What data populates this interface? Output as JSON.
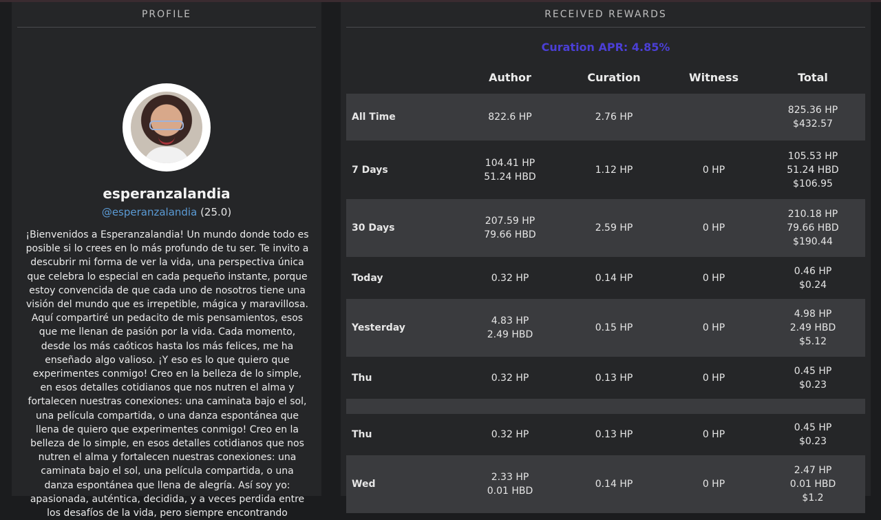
{
  "profile": {
    "header": "PROFILE",
    "display_name": "esperanzalandia",
    "handle": "@esperanzalandia",
    "reputation": "(25.0)",
    "bio": "¡Bienvenidos a Esperanzalandia! Un mundo donde todo es posible si lo crees en lo más profundo de tu ser. Te invito a descubrir mi forma de ver la vida, una perspectiva única que celebra lo especial en cada pequeño instante, porque estoy convencida de que cada uno de nosotros tiene una visión del mundo que es irrepetible, mágica y maravillosa. Aquí compartiré un pedacito de mis pensamientos, esos que me llenan de pasión por la vida. Cada momento, desde los más caóticos hasta los más felices, me ha enseñado algo valioso. ¡Y eso es lo que quiero que experimentes conmigo! Creo en la belleza de lo simple, en esos detalles cotidianos que nos nutren el alma y fortalecen nuestras conexiones: una caminata bajo el sol, una película compartida, o una danza espontánea que llena de quiero que experimentes conmigo! Creo en la belleza de lo simple, en esos detalles cotidianos que nos nutren el alma y fortalecen nuestras conexiones: una caminata bajo el sol, una película compartida, o una danza espontánea que llena de alegría. Así soy yo: apasionada, auténtica, decidida, y a veces perdida entre los desafíos de la vida, pero siempre encontrando"
  },
  "rewards": {
    "header": "RECEIVED REWARDS",
    "apr": "Curation APR: 4.85%",
    "columns": {
      "author": "Author",
      "curation": "Curation",
      "witness": "Witness",
      "total": "Total"
    },
    "rows": [
      {
        "label": "All Time",
        "author": [
          "822.6 HP"
        ],
        "curation": "2.76 HP",
        "witness": "",
        "total": [
          "825.36 HP",
          "$432.57"
        ]
      },
      {
        "label": "7 Days",
        "author": [
          "104.41 HP",
          "51.24 HBD"
        ],
        "curation": "1.12 HP",
        "witness": "0 HP",
        "total": [
          "105.53 HP",
          "51.24 HBD",
          "$106.95"
        ]
      },
      {
        "label": "30 Days",
        "author": [
          "207.59 HP",
          "79.66 HBD"
        ],
        "curation": "2.59 HP",
        "witness": "0 HP",
        "total": [
          "210.18 HP",
          "79.66 HBD",
          "$190.44"
        ]
      },
      {
        "label": "Today",
        "author": [
          "0.32 HP"
        ],
        "curation": "0.14 HP",
        "witness": "0 HP",
        "total": [
          "0.46 HP",
          "$0.24"
        ]
      },
      {
        "label": "Yesterday",
        "author": [
          "4.83 HP",
          "2.49 HBD"
        ],
        "curation": "0.15 HP",
        "witness": "0 HP",
        "total": [
          "4.98 HP",
          "2.49 HBD",
          "$5.12"
        ]
      },
      {
        "label": "Thu",
        "author": [
          "0.32 HP"
        ],
        "curation": "0.13 HP",
        "witness": "0 HP",
        "total": [
          "0.45 HP",
          "$0.23"
        ]
      },
      {
        "label": "Thu",
        "author": [
          "0.32 HP"
        ],
        "curation": "0.13 HP",
        "witness": "0 HP",
        "total": [
          "0.45 HP",
          "$0.23"
        ]
      },
      {
        "label": "Wed",
        "author": [
          "2.33 HP",
          "0.01 HBD"
        ],
        "curation": "0.14 HP",
        "witness": "0 HP",
        "total": [
          "2.47 HP",
          "0.01 HBD",
          "$1.2"
        ]
      }
    ]
  }
}
